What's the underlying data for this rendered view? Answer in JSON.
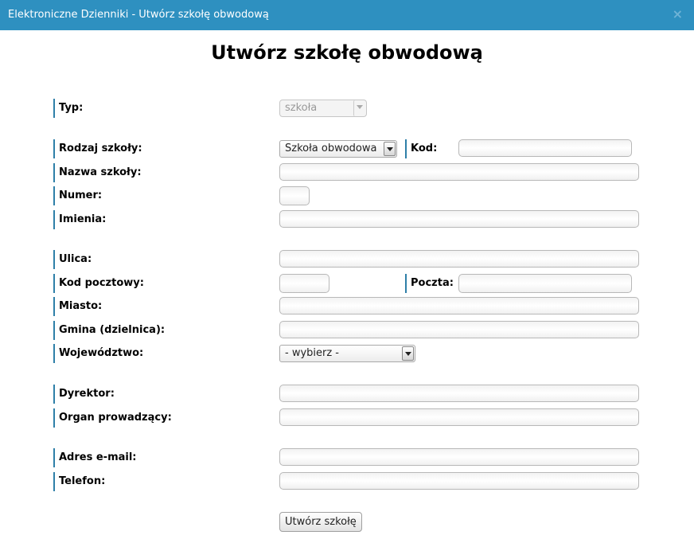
{
  "window": {
    "title": "Elektroniczne Dzienniki - Utwórz szkołę obwodową",
    "close_glyph": "×"
  },
  "page_title": "Utwórz szkołę obwodową",
  "form": {
    "typ": {
      "label": "Typ:",
      "value": "szkoła"
    },
    "rodzaj": {
      "label": "Rodzaj szkoły:",
      "value": "Szkoła obwodowa"
    },
    "kod": {
      "label": "Kod:",
      "value": ""
    },
    "nazwa": {
      "label": "Nazwa szkoły:",
      "value": ""
    },
    "numer": {
      "label": "Numer:",
      "value": ""
    },
    "imienia": {
      "label": "Imienia:",
      "value": ""
    },
    "ulica": {
      "label": "Ulica:",
      "value": ""
    },
    "kod_pocztowy": {
      "label": "Kod pocztowy:",
      "value": ""
    },
    "poczta": {
      "label": "Poczta:",
      "value": ""
    },
    "miasto": {
      "label": "Miasto:",
      "value": ""
    },
    "gmina": {
      "label": "Gmina (dzielnica):",
      "value": ""
    },
    "wojewodztwo": {
      "label": "Województwo:",
      "value": "- wybierz -"
    },
    "dyrektor": {
      "label": "Dyrektor:",
      "value": ""
    },
    "organ": {
      "label": "Organ prowadzący:",
      "value": ""
    },
    "email": {
      "label": "Adres e-mail:",
      "value": ""
    },
    "telefon": {
      "label": "Telefon:",
      "value": ""
    }
  },
  "submit_label": "Utwórz szkołę"
}
